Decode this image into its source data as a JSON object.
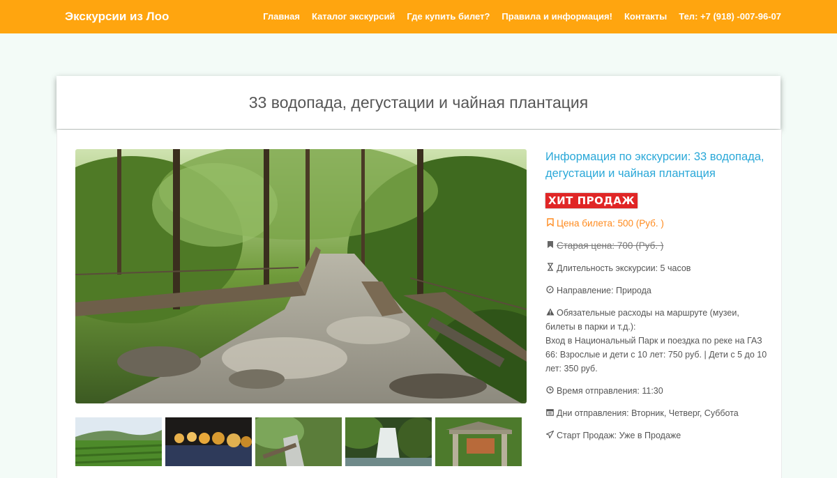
{
  "nav": {
    "brand": "Экскурсии из Лоо",
    "items": [
      "Главная",
      "Каталог экскурсий",
      "Где купить билет?",
      "Правила и информация!",
      "Контакты",
      "Тел: +7 (918) -007-96-07"
    ]
  },
  "page": {
    "title": "33 водопада, дегустации и чайная плантация"
  },
  "info": {
    "heading": "Информация по экскурсии: 33 водопада, дегустации и чайная плантация",
    "badge": "ХИТ ПРОДАЖ",
    "price": "Цена билета: 500 (Руб. )",
    "old_price": "Старая цена: 700 (Руб. )",
    "duration": "Длительность экскурсии: 5 часов",
    "direction": "Направление: Природа",
    "expenses_title": "Обязательные расходы на маршруте (музеи, билеты в парки и т.д.):",
    "expenses_text": "Вход в Национальный Парк и поездка по реке на ГАЗ 66: Взрослые и дети с 10 лет: 750 руб. | Дети с 5 до 10 лет: 350 руб.",
    "departure_time": "Время отправления: 11:30",
    "departure_days": "Дни отправления: Вторник, Четверг, Суббота",
    "sale_start": "Старт Продаж: Уже в Продаже"
  },
  "icons": {
    "price": "bookmark-outline-icon",
    "old_price": "bookmark-solid-icon",
    "duration": "hourglass-icon",
    "direction": "compass-icon",
    "expenses": "warning-icon",
    "departure_time": "clock-icon",
    "departure_days": "calendar-icon",
    "sale_start": "paper-plane-icon"
  },
  "colors": {
    "navbar": "#ffa50f",
    "heading": "#2aa8d8",
    "price": "#ff8a1d",
    "badge": "#e02626",
    "background": "#f3fbf7"
  }
}
